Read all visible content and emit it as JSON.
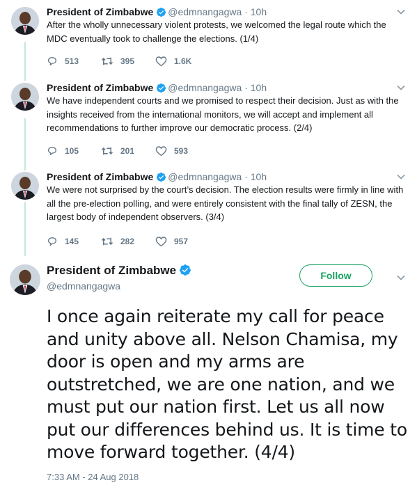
{
  "account": {
    "name": "President of Zimbabwe",
    "handle": "@edmnangagwa"
  },
  "colors": {
    "verified": "#1da1f2",
    "thread_line": "#c4e8d4",
    "follow_accent": "#1aa260",
    "secondary_text": "#657786"
  },
  "tweets": [
    {
      "time": "10h",
      "text": "After the wholly unnecessary violent protests, we welcomed the legal route which the MDC eventually took to challenge the elections. (1/4)",
      "replies": "513",
      "retweets": "395",
      "likes": "1.6K"
    },
    {
      "time": "10h",
      "text": "We have independent courts and we promised to respect their decision. Just as with the insights received from the international monitors, we will accept and implement all recommendations to further improve our democratic process. (2/4)",
      "replies": "105",
      "retweets": "201",
      "likes": "593"
    },
    {
      "time": "10h",
      "text": "We were not surprised by the court’s decision. The election results were firmly in line with all the pre-election polling, and were entirely consistent with the final tally of ZESN, the largest body of independent observers. (3/4)",
      "replies": "145",
      "retweets": "282",
      "likes": "957"
    }
  ],
  "main_tweet": {
    "follow_label": "Follow",
    "text": "I once again reiterate my call for peace and unity above all. Nelson Chamisa, my door is open and my arms are outstretched, we are one nation, and we must put our nation first. Let us all now put our differences behind us. It is time to move forward together. (4/4)",
    "timestamp": "7:33 AM - 24 Aug 2018"
  },
  "separator": "·",
  "icons": {
    "reply": "reply-icon",
    "retweet": "retweet-icon",
    "like": "heart-icon",
    "verified": "verified-badge-icon",
    "more": "chevron-down-icon"
  }
}
